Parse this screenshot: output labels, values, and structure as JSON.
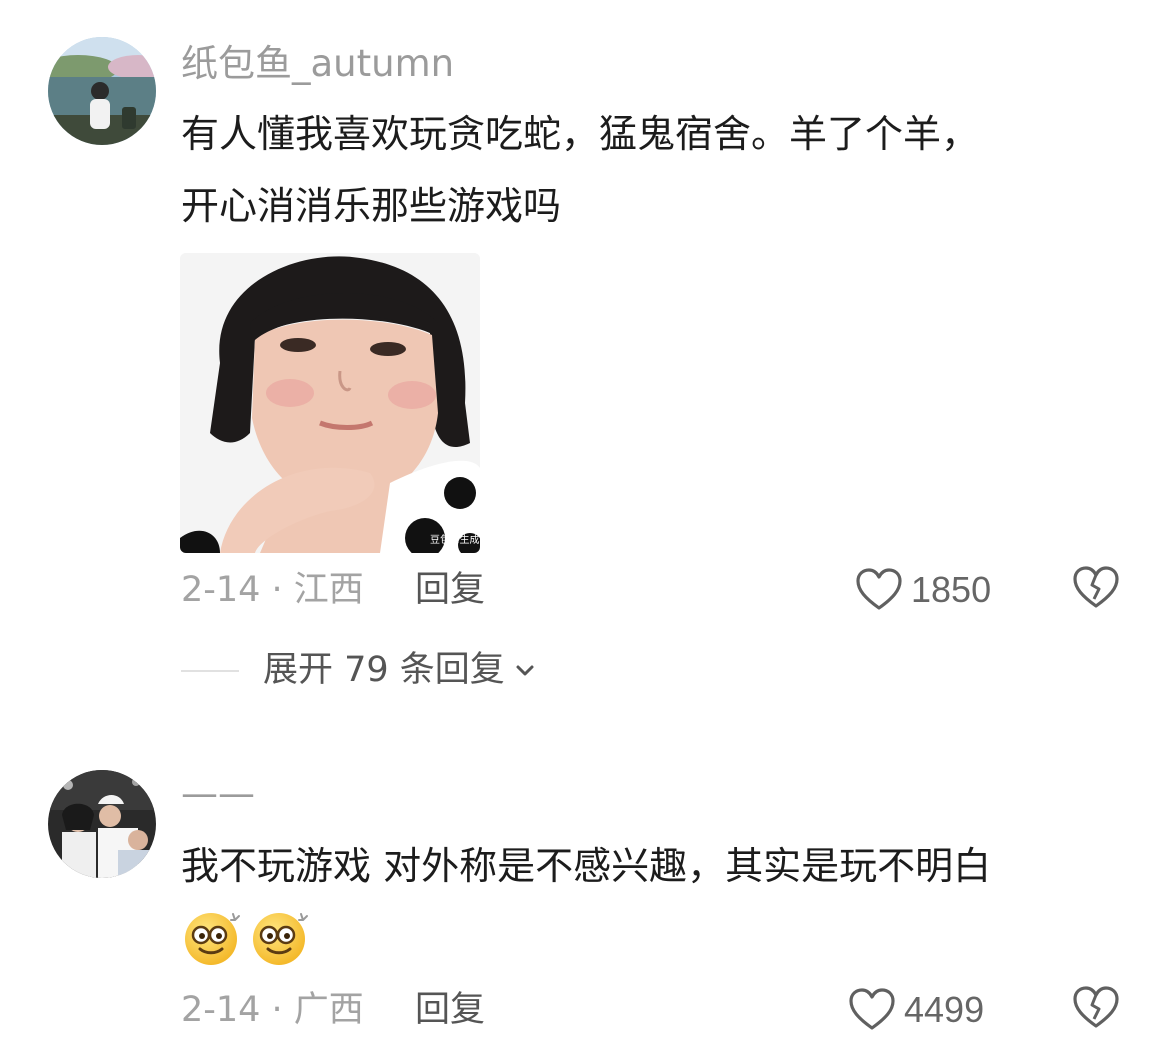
{
  "comments": [
    {
      "username": "纸包鱼_autumn",
      "text_line1": "有人懂我喜欢玩贪吃蛇，猛鬼宿舍。羊了个羊，",
      "text_line2": "开心消消乐那些游戏吗",
      "image_watermark": "豆包AI生成",
      "meta": "2-14 · 江西",
      "reply_label": "回复",
      "likes": "1850",
      "expand_label": "展开 79 条回复"
    },
    {
      "username": "——",
      "text_line1": "我不玩游戏 对外称是不感兴趣，其实是玩不明白",
      "emojis": [
        "dizzy-eyes-emoji",
        "dizzy-eyes-emoji"
      ],
      "meta": "2-14 · 广西",
      "reply_label": "回复",
      "likes": "4499"
    }
  ],
  "colors": {
    "username": "#9b9b9b",
    "text": "#1c1c1c",
    "meta": "#a3a3a3",
    "action": "#555555"
  }
}
